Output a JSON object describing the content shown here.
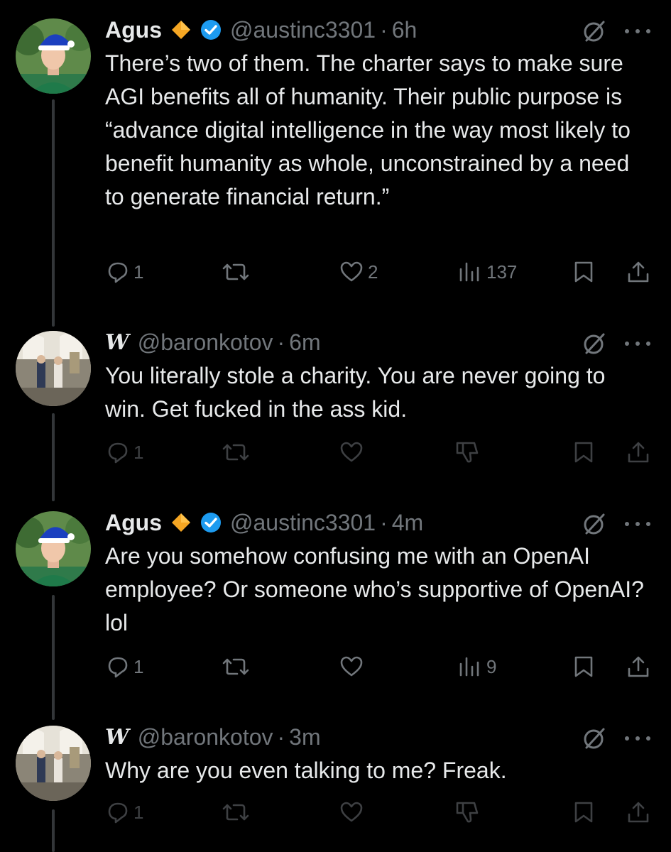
{
  "tweets": [
    {
      "author": "Agus",
      "handle": "@austinc3301",
      "time": "6h",
      "text": "There’s two of them. The charter says to make sure AGI benefits all of humanity. Their public purpose is “advance digital intelligence in the way most likely to benefit humanity as whole, unconstrained by a need to generate financial return.”",
      "replies": "1",
      "likes": "2",
      "views": "137"
    },
    {
      "author": "W",
      "handle": "@baronkotov",
      "time": "6m",
      "text": "You literally stole a charity. You are never going to win. Get fucked in the ass kid.",
      "replies": "1"
    },
    {
      "author": "Agus",
      "handle": "@austinc3301",
      "time": "4m",
      "text": "Are you somehow confusing me with an OpenAI employee? Or someone who’s supportive of OpenAI? lol",
      "replies": "1",
      "views": "9"
    },
    {
      "author": "W",
      "handle": "@baronkotov",
      "time": "3m",
      "text": "Why are you even talking to me? Freak.",
      "replies": "1"
    }
  ],
  "separator": "·",
  "colors": {
    "background": "#000000",
    "text": "#e7e9ea",
    "muted": "#71767b",
    "verified": "#1d9bf0",
    "diamond": "#f5a623"
  }
}
